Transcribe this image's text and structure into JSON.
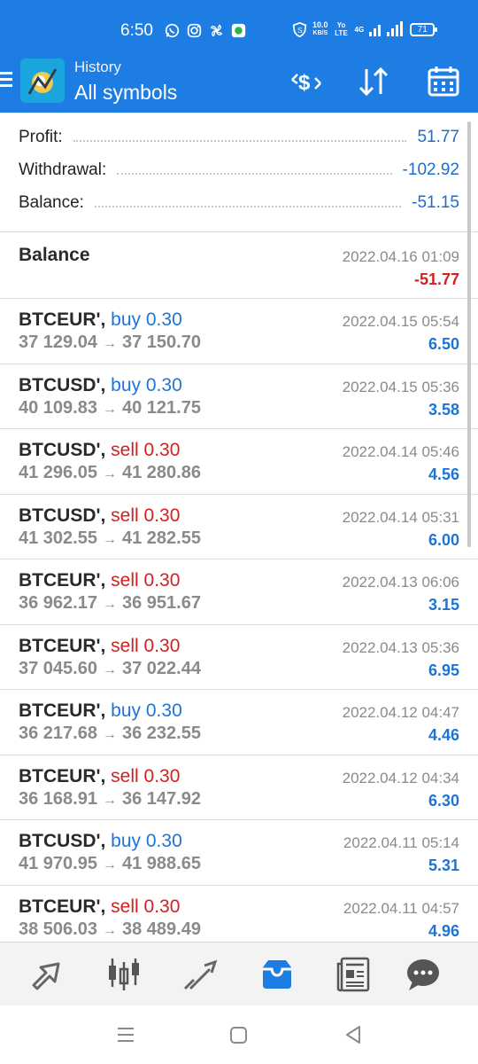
{
  "status_bar": {
    "time": "6:50",
    "net_speed_value": "10.0",
    "net_speed_unit": "KB/S",
    "volte_label": "Yo LTE",
    "network_label": "4G",
    "battery": "71"
  },
  "header": {
    "subtitle": "History",
    "title": "All symbols",
    "actions": [
      "currency-exchange-icon",
      "sort-icon",
      "calendar-icon"
    ],
    "accent": "#1d7de3"
  },
  "summary": [
    {
      "label": "Profit:",
      "value": "51.77"
    },
    {
      "label": "Withdrawal:",
      "value": "-102.92"
    },
    {
      "label": "Balance:",
      "value": "-51.15"
    }
  ],
  "balance_entry": {
    "title": "Balance",
    "date": "2022.04.16 01:09",
    "amount": "-51.77"
  },
  "deals": [
    {
      "symbol": "BTCEUR',",
      "side": "buy",
      "volume": "0.30",
      "open": "37 129.04",
      "close": "37 150.70",
      "date": "2022.04.15 05:54",
      "profit": "6.50"
    },
    {
      "symbol": "BTCUSD',",
      "side": "buy",
      "volume": "0.30",
      "open": "40 109.83",
      "close": "40 121.75",
      "date": "2022.04.15 05:36",
      "profit": "3.58"
    },
    {
      "symbol": "BTCUSD',",
      "side": "sell",
      "volume": "0.30",
      "open": "41 296.05",
      "close": "41 280.86",
      "date": "2022.04.14 05:46",
      "profit": "4.56"
    },
    {
      "symbol": "BTCUSD',",
      "side": "sell",
      "volume": "0.30",
      "open": "41 302.55",
      "close": "41 282.55",
      "date": "2022.04.14 05:31",
      "profit": "6.00"
    },
    {
      "symbol": "BTCEUR',",
      "side": "sell",
      "volume": "0.30",
      "open": "36 962.17",
      "close": "36 951.67",
      "date": "2022.04.13 06:06",
      "profit": "3.15"
    },
    {
      "symbol": "BTCEUR',",
      "side": "sell",
      "volume": "0.30",
      "open": "37 045.60",
      "close": "37 022.44",
      "date": "2022.04.13 05:36",
      "profit": "6.95"
    },
    {
      "symbol": "BTCEUR',",
      "side": "buy",
      "volume": "0.30",
      "open": "36 217.68",
      "close": "36 232.55",
      "date": "2022.04.12 04:47",
      "profit": "4.46"
    },
    {
      "symbol": "BTCEUR',",
      "side": "sell",
      "volume": "0.30",
      "open": "36 168.91",
      "close": "36 147.92",
      "date": "2022.04.12 04:34",
      "profit": "6.30"
    },
    {
      "symbol": "BTCUSD',",
      "side": "buy",
      "volume": "0.30",
      "open": "41 970.95",
      "close": "41 988.65",
      "date": "2022.04.11 05:14",
      "profit": "5.31"
    },
    {
      "symbol": "BTCEUR',",
      "side": "sell",
      "volume": "0.30",
      "open": "38 506.03",
      "close": "38 489.49",
      "date": "2022.04.11 04:57",
      "profit": "4.96"
    }
  ],
  "price_arrow": "→",
  "bottom_nav": {
    "items": [
      "quotes-icon",
      "chart-icon",
      "trade-icon",
      "history-icon",
      "news-icon",
      "chat-icon"
    ],
    "active": "history-icon"
  },
  "colors": {
    "buy": "#1e74d6",
    "sell": "#d32020",
    "profit_positive": "#1e74d6",
    "profit_negative": "#d32020"
  }
}
